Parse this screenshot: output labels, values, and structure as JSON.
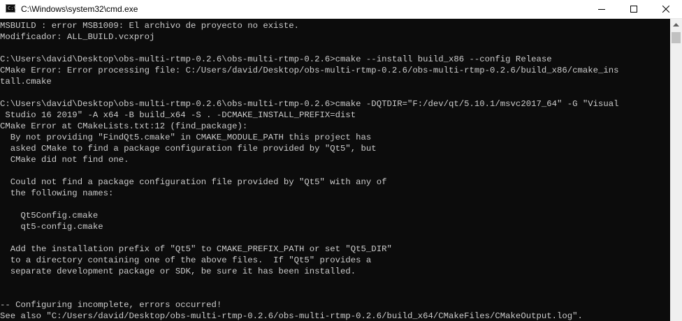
{
  "window": {
    "title": "C:\\Windows\\system32\\cmd.exe",
    "icon_label": "C:\\"
  },
  "icons": {
    "app": "command-prompt-icon",
    "minimize": "minimize-icon",
    "maximize": "maximize-icon",
    "close": "close-icon",
    "scroll_up": "scroll-up-arrow-icon"
  },
  "terminal": {
    "lines": [
      "MSBUILD : error MSB1009: El archivo de proyecto no existe.",
      "Modificador: ALL_BUILD.vcxproj",
      "",
      "C:\\Users\\david\\Desktop\\obs-multi-rtmp-0.2.6\\obs-multi-rtmp-0.2.6>cmake --install build_x86 --config Release",
      "CMake Error: Error processing file: C:/Users/david/Desktop/obs-multi-rtmp-0.2.6/obs-multi-rtmp-0.2.6/build_x86/cmake_ins",
      "tall.cmake",
      "",
      "C:\\Users\\david\\Desktop\\obs-multi-rtmp-0.2.6\\obs-multi-rtmp-0.2.6>cmake -DQTDIR=\"F:/dev/qt/5.10.1/msvc2017_64\" -G \"Visual",
      " Studio 16 2019\" -A x64 -B build_x64 -S . -DCMAKE_INSTALL_PREFIX=dist",
      "CMake Error at CMakeLists.txt:12 (find_package):",
      "  By not providing \"FindQt5.cmake\" in CMAKE_MODULE_PATH this project has",
      "  asked CMake to find a package configuration file provided by \"Qt5\", but",
      "  CMake did not find one.",
      "",
      "  Could not find a package configuration file provided by \"Qt5\" with any of",
      "  the following names:",
      "",
      "    Qt5Config.cmake",
      "    qt5-config.cmake",
      "",
      "  Add the installation prefix of \"Qt5\" to CMAKE_PREFIX_PATH or set \"Qt5_DIR\"",
      "  to a directory containing one of the above files.  If \"Qt5\" provides a",
      "  separate development package or SDK, be sure it has been installed.",
      "",
      "",
      "-- Configuring incomplete, errors occurred!",
      "See also \"C:/Users/david/Desktop/obs-multi-rtmp-0.2.6/obs-multi-rtmp-0.2.6/build_x64/CMakeFiles/CMakeOutput.log\"."
    ]
  },
  "colors": {
    "terminal_background": "#0c0c0c",
    "terminal_text": "#cccccc",
    "titlebar_background": "#ffffff",
    "scrollbar_track": "#f0f0f0",
    "scrollbar_thumb": "#c1c1c1"
  }
}
